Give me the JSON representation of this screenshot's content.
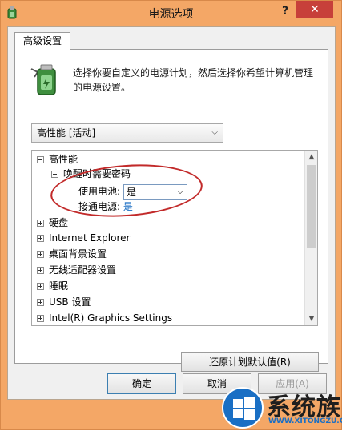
{
  "window": {
    "title": "电源选项",
    "help_label": "?",
    "close_label": "✕"
  },
  "tab": {
    "label": "高级设置"
  },
  "description": "选择你要自定义的电源计划，然后选择你希望计算机管理的电源设置。",
  "plan_select": {
    "value": "高性能 [活动]"
  },
  "tree": {
    "root": "高性能",
    "group": "唤醒时需要密码",
    "battery_label": "使用电池:",
    "battery_value": "是",
    "ac_label": "接通电源:",
    "ac_value": "是",
    "items": [
      "硬盘",
      "Internet Explorer",
      "桌面背景设置",
      "无线适配器设置",
      "睡眠",
      "USB 设置",
      "Intel(R) Graphics Settings"
    ]
  },
  "buttons": {
    "restore": "还原计划默认值(R)",
    "ok": "确定",
    "cancel": "取消",
    "apply": "应用(A)"
  },
  "watermark": {
    "text": "系统族",
    "url": "WWW.XITONGZU.COM"
  },
  "colors": {
    "title_bar": "#f4a766",
    "close_button": "#c7403a",
    "link_value": "#1c6fc4",
    "highlight": "#c22a2a"
  },
  "icons": {
    "title": "power-options-icon",
    "power": "battery-plug-icon",
    "logo": "windows-logo-icon"
  }
}
